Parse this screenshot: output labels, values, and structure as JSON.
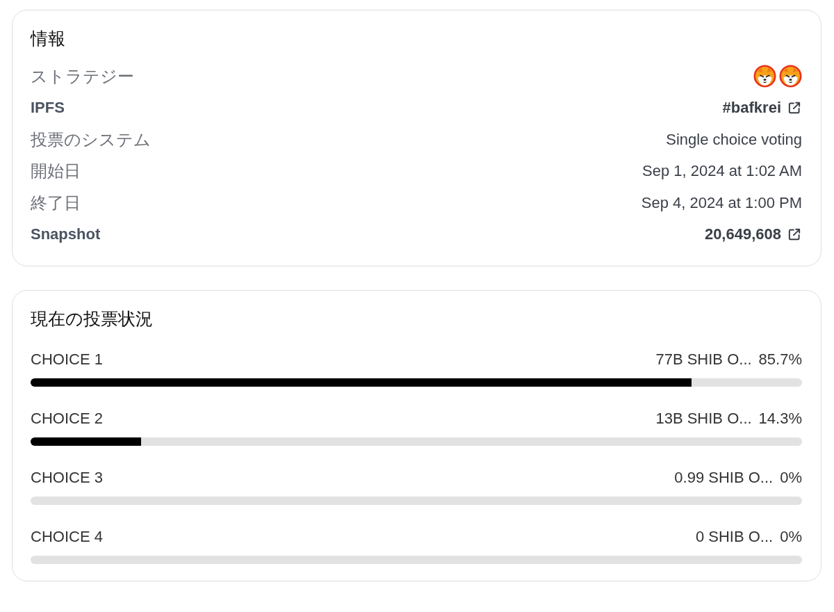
{
  "info": {
    "title": "情報",
    "rows": [
      {
        "label": "ストラテジー",
        "kind": "avatars",
        "avatars": [
          {
            "kind": "token"
          },
          {
            "kind": "token"
          }
        ]
      },
      {
        "label": "IPFS",
        "kind": "link",
        "value": "#bafkrei"
      },
      {
        "label": "投票のシステム",
        "kind": "text",
        "value": "Single choice voting"
      },
      {
        "label": "開始日",
        "kind": "text",
        "value": "Sep 1, 2024 at 1:02 AM"
      },
      {
        "label": "終了日",
        "kind": "text",
        "value": "Sep 4, 2024 at 1:00 PM"
      },
      {
        "label": "Snapshot",
        "kind": "link",
        "value": "20,649,608"
      }
    ]
  },
  "results": {
    "title": "現在の投票状況",
    "choices": [
      {
        "name": "CHOICE 1",
        "amount": "77B SHIB O...",
        "percent": "85.7%",
        "level": 0.857
      },
      {
        "name": "CHOICE 2",
        "amount": "13B SHIB O...",
        "percent": "14.3%",
        "level": 0.143
      },
      {
        "name": "CHOICE 3",
        "amount": "0.99 SHIB O...",
        "percent": "0%",
        "level": 0
      },
      {
        "name": "CHOICE 4",
        "amount": "0 SHIB O...",
        "percent": "0%",
        "level": 0
      }
    ]
  }
}
